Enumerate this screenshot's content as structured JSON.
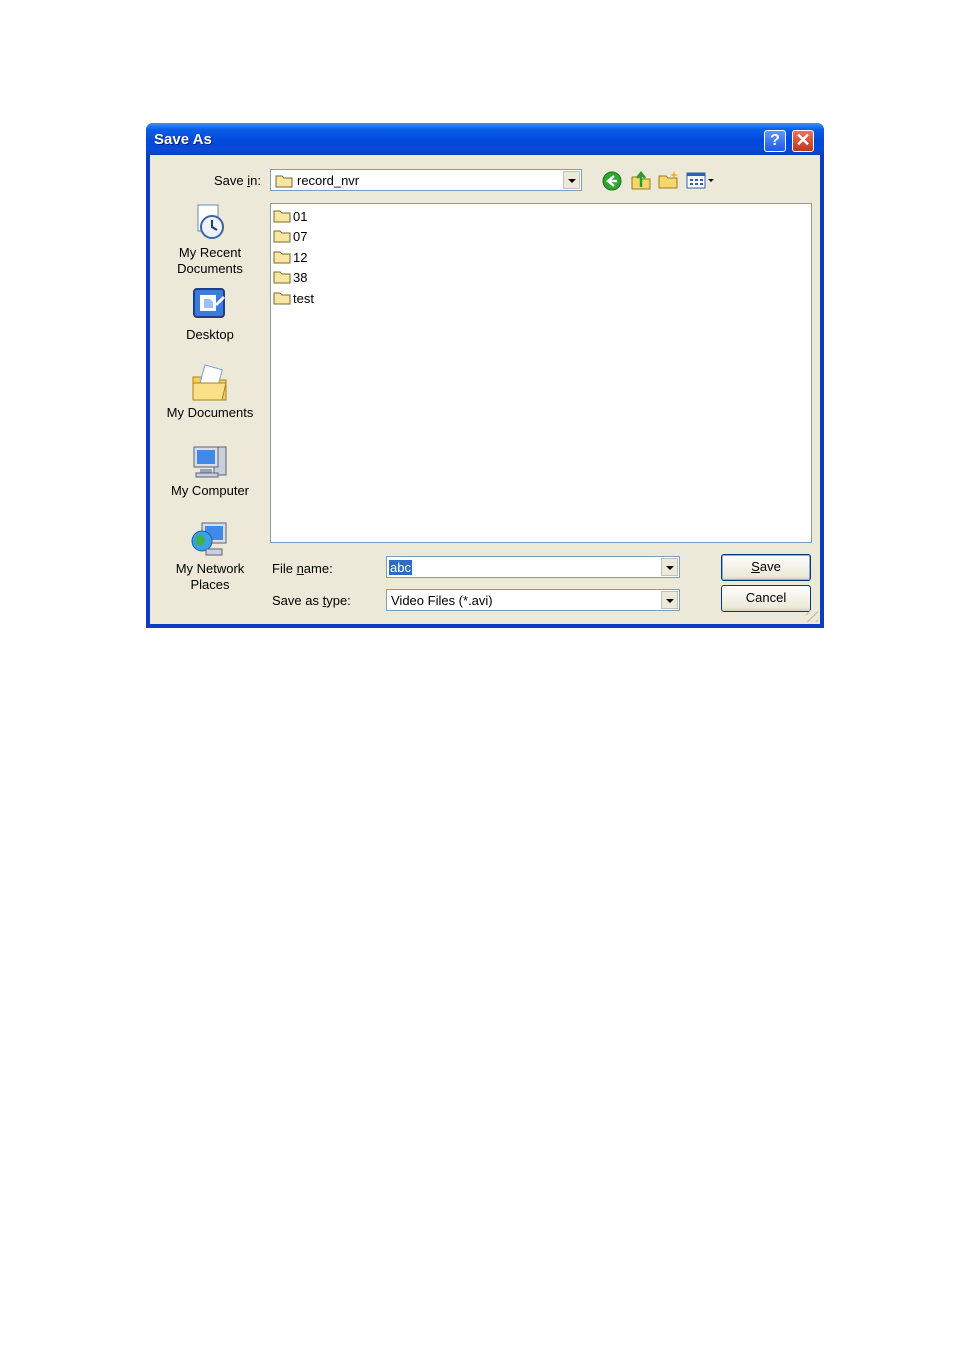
{
  "window": {
    "title": "Save As",
    "help_glyph": "?",
    "close_glyph": "✕"
  },
  "save_in": {
    "label_pre": "Save ",
    "label_u": "i",
    "label_post": "n:",
    "value": "record_nvr",
    "icon": "folder-icon"
  },
  "toolbar": {
    "icons": [
      "back-icon",
      "up-folder-icon",
      "new-folder-icon",
      "views-menu-icon"
    ]
  },
  "places": [
    {
      "line1": "My Recent",
      "line2": "Documents",
      "icon": "recent-documents-icon"
    },
    {
      "line1": "Desktop",
      "line2": "",
      "icon": "desktop-icon"
    },
    {
      "line1": "My Documents",
      "line2": "",
      "icon": "my-documents-icon"
    },
    {
      "line1": "My Computer",
      "line2": "",
      "icon": "my-computer-icon"
    },
    {
      "line1": "My Network",
      "line2": "Places",
      "icon": "network-places-icon"
    }
  ],
  "files": [
    {
      "name": "01"
    },
    {
      "name": "07"
    },
    {
      "name": "12"
    },
    {
      "name": "38"
    },
    {
      "name": "test"
    }
  ],
  "file_name": {
    "label_pre": "File ",
    "label_u": "n",
    "label_post": "ame:",
    "value": "abc"
  },
  "save_as_type": {
    "label_pre": "Save as ",
    "label_u": "t",
    "label_post": "ype:",
    "value": "Video Files (*.avi)"
  },
  "buttons": {
    "save_u": "S",
    "save_rest": "ave",
    "cancel": "Cancel"
  },
  "colors": {
    "titlebar": "#0a5fe6",
    "dialog_face": "#ece9d8",
    "selection": "#316ac5"
  }
}
